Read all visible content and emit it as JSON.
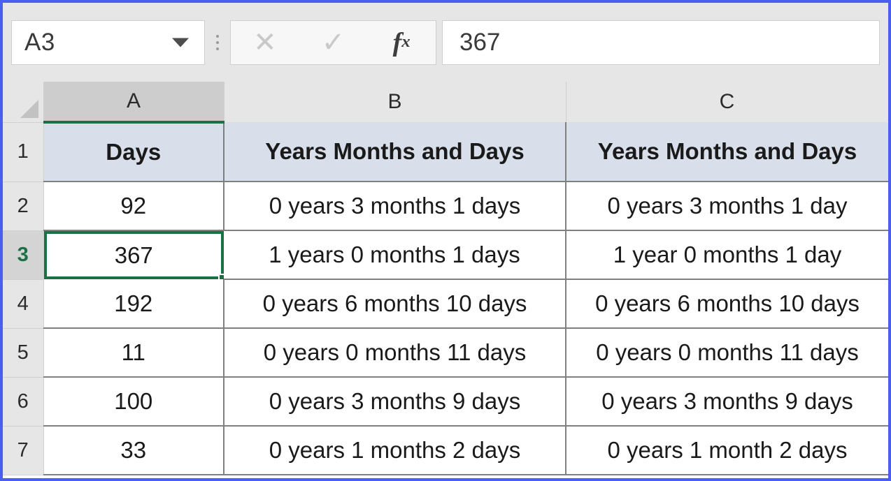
{
  "app": {
    "name_box_value": "A3",
    "formula_bar_value": "367"
  },
  "toolbar": {
    "cancel_label": "✕",
    "confirm_label": "✓",
    "insert_function_label": "fx"
  },
  "grid": {
    "column_headers": [
      "A",
      "B",
      "C"
    ],
    "active_column": "A",
    "row_headers": [
      "1",
      "2",
      "3",
      "4",
      "5",
      "6",
      "7"
    ],
    "active_row": "3",
    "selected_cell": "A3",
    "header_row": {
      "a": "Days",
      "b": "Years Months and Days",
      "c": "Years Months and Days"
    },
    "rows": [
      {
        "n": "2",
        "a": "92",
        "b": "0 years 3 months 1 days",
        "c": "0 years 3 months 1 day"
      },
      {
        "n": "3",
        "a": "367",
        "b": "1 years 0 months 1 days",
        "c": "1 year 0 months 1 day"
      },
      {
        "n": "4",
        "a": "192",
        "b": "0 years 6 months 10 days",
        "c": "0 years 6 months 10 days"
      },
      {
        "n": "5",
        "a": "11",
        "b": "0 years 0 months 11 days",
        "c": "0 years 0 months 11 days"
      },
      {
        "n": "6",
        "a": "100",
        "b": "0 years 3 months 9 days",
        "c": "0 years 3 months 9 days"
      },
      {
        "n": "7",
        "a": "33",
        "b": "0 years 1 months 2 days",
        "c": "0 years 1 month 2 days"
      }
    ]
  },
  "colors": {
    "selection_green": "#1d7044",
    "header_fill": "#d9dfea",
    "chrome_gray": "#e6e6e6",
    "frame_blue": "#4a5ef0"
  }
}
